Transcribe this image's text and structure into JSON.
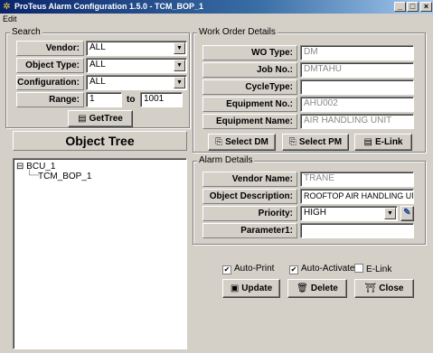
{
  "window": {
    "title": "ProTeus Alarm Configuration 1.5.0 - TCM_BOP_1",
    "minimize": "_",
    "maximize": "□",
    "close": "×"
  },
  "menu": {
    "edit": "Edit"
  },
  "search": {
    "title": "Search",
    "vendor_label": "Vendor:",
    "vendor_value": "ALL",
    "object_type_label": "Object Type:",
    "object_type_value": "ALL",
    "configuration_label": "Configuration:",
    "configuration_value": "ALL",
    "range_label": "Range:",
    "range_from": "1",
    "range_to_label": "to",
    "range_to": "1001",
    "gettree_label": "GetTree"
  },
  "object_tree": {
    "title": "Object Tree",
    "nodes": [
      "BCU_1",
      "TCM_BOP_1"
    ]
  },
  "work_order": {
    "title": "Work Order Details",
    "wo_type_label": "WO Type:",
    "wo_type_value": "DM",
    "job_no_label": "Job No.:",
    "job_no_value": "DMTAHU",
    "cycle_type_label": "CycleType:",
    "cycle_type_value": "",
    "equipment_no_label": "Equipment No.:",
    "equipment_no_value": "AHU002",
    "equipment_name_label": "Equipment Name:",
    "equipment_name_value": "AIR HANDLING UNIT",
    "select_dm_label": "Select DM",
    "select_pm_label": "Select PM",
    "elink_label": "E-Link"
  },
  "alarm": {
    "title": "Alarm Details",
    "vendor_name_label": "Vendor Name:",
    "vendor_name_value": "TRANE",
    "object_description_label": "Object Description:",
    "object_description_value": "ROOFTOP AIR HANDLING UNIT",
    "priority_label": "Priority:",
    "priority_value": "HIGH",
    "parameter1_label": "Parameter1:",
    "parameter1_value": ""
  },
  "options": {
    "auto_print_label": "Auto-Print",
    "auto_print_checked": true,
    "auto_activate_label": "Auto-Activate",
    "auto_activate_checked": true,
    "elink_label": "E-Link",
    "elink_checked": false
  },
  "actions": {
    "update_label": "Update",
    "delete_label": "Delete",
    "close_label": "Close"
  }
}
